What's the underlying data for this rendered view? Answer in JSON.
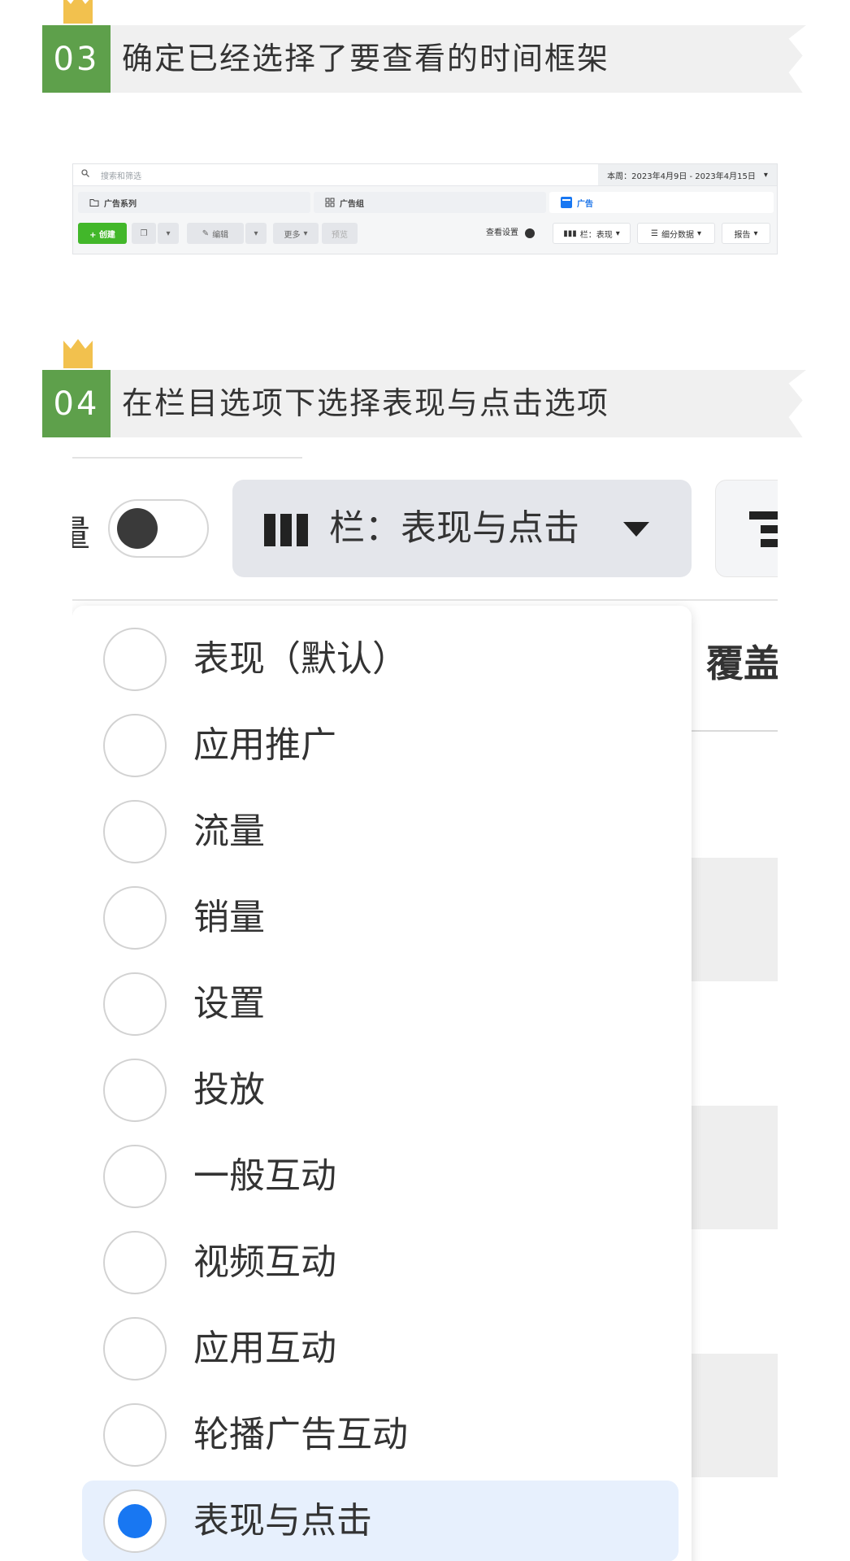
{
  "step3": {
    "number": "03",
    "text": "确定已经选择了要查看的时间框架"
  },
  "step4": {
    "number": "04",
    "text": "在栏目选项下选择表现与点击选项"
  },
  "colors": {
    "step_green": "#5ea04b",
    "crown_yellow": "#f2c14e",
    "accent_blue": "#1877f2",
    "create_green": "#42b72a"
  },
  "toolbar_screenshot": {
    "search_placeholder": "搜索和筛选",
    "date_range": "本周：2023年4月9日 - 2023年4月15日",
    "tabs": [
      {
        "label": "广告系列",
        "icon": "folder-icon"
      },
      {
        "label": "广告组",
        "icon": "grid-icon"
      },
      {
        "label": "广告",
        "icon": "ad-icon"
      }
    ],
    "create_label": "+ 创建",
    "edit_label": "编辑",
    "more_label": "更多",
    "preview_label": "预览",
    "view_settings_label": "查看设置",
    "columns_label": "栏：表现",
    "breakdown_label": "细分数据",
    "reports_label": "报告"
  },
  "zoom_screenshot": {
    "partial_label": "量",
    "columns_button": "栏：表现与点击",
    "partial_header": "覆盖",
    "menu_items": [
      {
        "label": "表现（默认）",
        "selected": false
      },
      {
        "label": "应用推广",
        "selected": false
      },
      {
        "label": "流量",
        "selected": false
      },
      {
        "label": "销量",
        "selected": false
      },
      {
        "label": "设置",
        "selected": false
      },
      {
        "label": "投放",
        "selected": false
      },
      {
        "label": "一般互动",
        "selected": false
      },
      {
        "label": "视频互动",
        "selected": false
      },
      {
        "label": "应用互动",
        "selected": false
      },
      {
        "label": "轮播广告互动",
        "selected": false
      },
      {
        "label": "表现与点击",
        "selected": true
      }
    ]
  }
}
